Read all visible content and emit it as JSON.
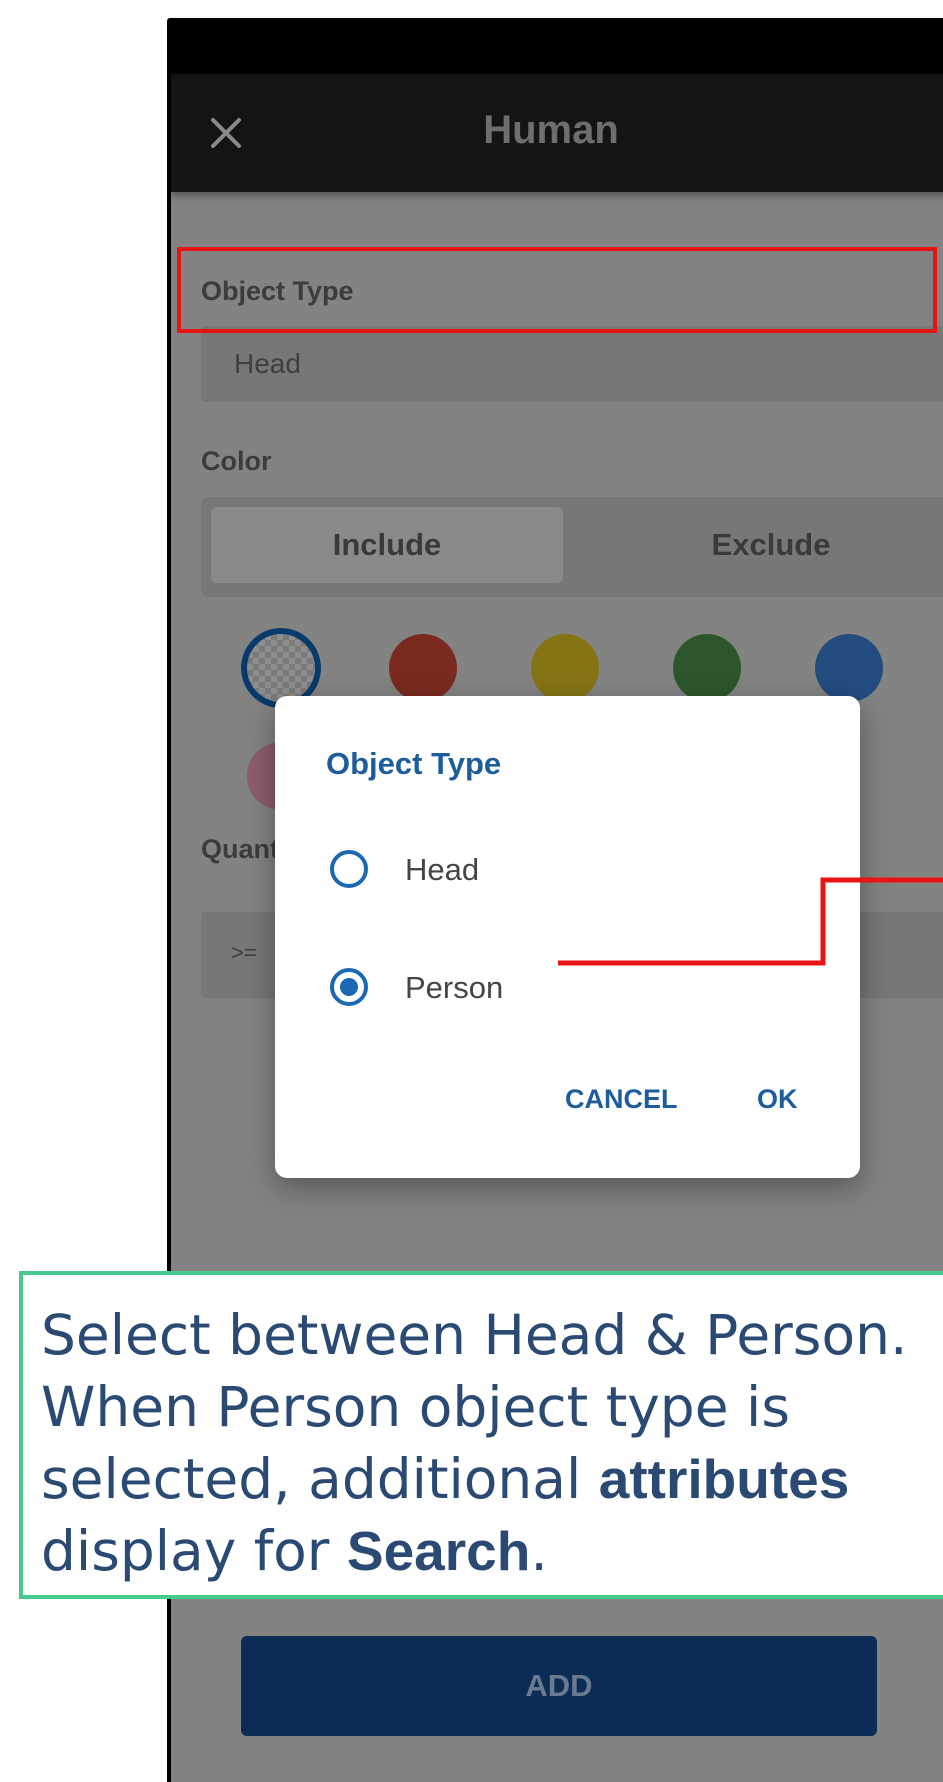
{
  "app_bar": {
    "title": "Human",
    "close_icon": "close-icon"
  },
  "form": {
    "object_type": {
      "label": "Object Type",
      "value": "Head"
    },
    "color": {
      "label": "Color",
      "include_label": "Include",
      "exclude_label": "Exclude",
      "selected_mode": "Include",
      "swatches": [
        "transparent",
        "red",
        "yellow",
        "green",
        "blue",
        "pink"
      ]
    },
    "quantity": {
      "label": "Quant",
      "value": ">= "
    },
    "add_label": "ADD"
  },
  "dialog": {
    "title": "Object Type",
    "options": [
      {
        "label": "Head",
        "checked": false
      },
      {
        "label": "Person",
        "checked": true
      }
    ],
    "cancel_label": "CANCEL",
    "ok_label": "OK"
  },
  "callout": {
    "line1": "Select between Head & Person.",
    "line2": "When Person object type is",
    "line3_prefix": "selected, additional ",
    "line3_bold": "attributes",
    "line4_prefix": "display for ",
    "line4_bold": "Search",
    "line4_suffix": "."
  },
  "colors": {
    "highlight_red": "#e81414",
    "callout_border": "#45c98c",
    "callout_text": "#2b4a73",
    "dialog_accent": "#1d5d9c",
    "add_button": "#0b2c55"
  }
}
